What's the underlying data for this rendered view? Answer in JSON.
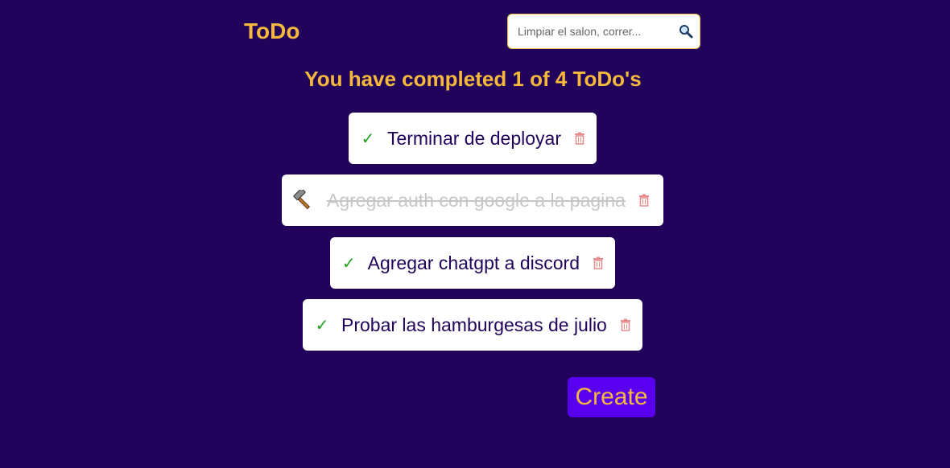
{
  "app": {
    "title": "ToDo"
  },
  "search": {
    "placeholder": "Limpiar el salon, correr...",
    "value": "",
    "icon": "magnifier-icon"
  },
  "counter": {
    "text": "You have completed 1 of 4 ToDo's",
    "completed": 1,
    "total": 4
  },
  "todos": [
    {
      "text": "Terminar de deployar",
      "completed": false,
      "status_icon": "check-icon"
    },
    {
      "text": "Agregar auth con google a la pagina",
      "completed": true,
      "status_icon": "hammer-icon"
    },
    {
      "text": "Agregar chatgpt a discord",
      "completed": false,
      "status_icon": "check-icon"
    },
    {
      "text": "Probar las hamburgesas de julio",
      "completed": false,
      "status_icon": "check-icon"
    }
  ],
  "create_button": {
    "label": "Create"
  },
  "colors": {
    "background": "#21035b",
    "accent": "#f6b93b",
    "button": "#5a00f0",
    "check": "#1ea21e",
    "delete": "#e88a8a"
  }
}
